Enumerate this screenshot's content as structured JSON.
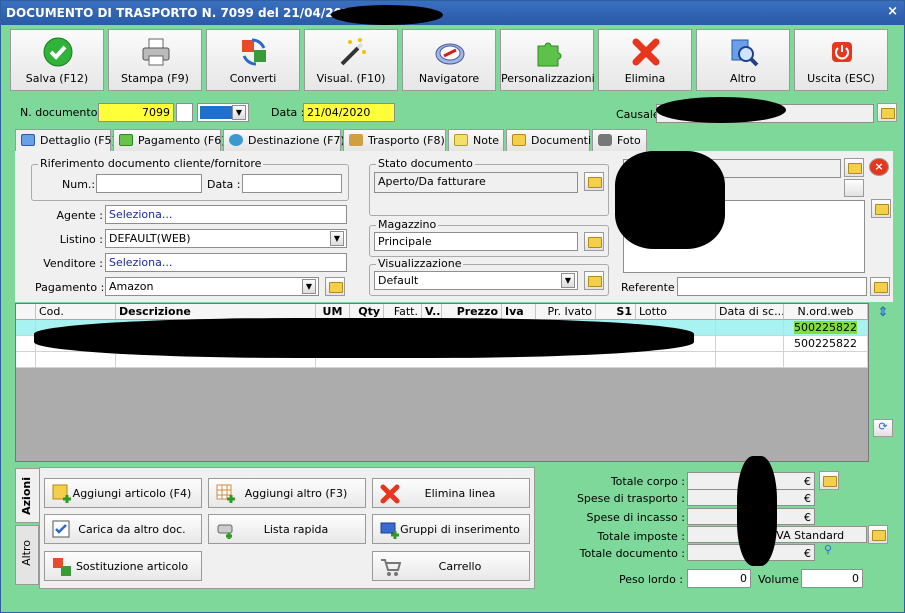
{
  "window": {
    "title": "DOCUMENTO DI TRASPORTO N. 7099 del 21/04/2020",
    "close_icon": "×"
  },
  "toolbar": [
    {
      "label": "Salva (F12)",
      "icon": "check-icon"
    },
    {
      "label": "Stampa (F9)",
      "icon": "printer-icon"
    },
    {
      "label": "Converti",
      "icon": "convert-icon"
    },
    {
      "label": "Visual. (F10)",
      "icon": "magic-wand-icon"
    },
    {
      "label": "Navigatore",
      "icon": "compass-icon"
    },
    {
      "label": "Personalizzazioni",
      "icon": "puzzle-icon"
    },
    {
      "label": "Elimina",
      "icon": "red-x-icon"
    },
    {
      "label": "Altro",
      "icon": "magnifier-icon"
    },
    {
      "label": "Uscita (ESC)",
      "icon": "power-icon"
    }
  ],
  "header": {
    "ndoc_label": "N. documento :",
    "ndoc_value": "7099",
    "data_label": "Data :",
    "data_value": "21/04/2020",
    "causale_label": "Causale"
  },
  "tabs": [
    "Dettaglio (F5)",
    "Pagamento (F6)",
    "Destinazione (F7)",
    "Trasporto (F8)",
    "Note",
    "Documenti",
    "Foto"
  ],
  "dettaglio": {
    "rif_legend": "Riferimento documento cliente/fornitore",
    "num_label": "Num.:",
    "data_label": "Data :",
    "agente_label": "Agente :",
    "agente_value": "Seleziona...",
    "listino_label": "Listino :",
    "listino_value": "DEFAULT(WEB)",
    "venditore_label": "Venditore :",
    "venditore_value": "Seleziona...",
    "pagamento_label": "Pagamento :",
    "pagamento_value": "Amazon",
    "stato_legend": "Stato documento",
    "stato_value": "Aperto/Da fatturare",
    "magazzino_legend": "Magazzino",
    "magazzino_value": "Principale",
    "visual_legend": "Visualizzazione",
    "visual_value": "Default",
    "referente_label": "Referente"
  },
  "grid": {
    "columns": [
      "Cod.",
      "Descrizione",
      "UM",
      "Qty",
      "Fatt.",
      "V...",
      "Prezzo",
      "Iva",
      "Pr. Ivato",
      "S1",
      "Lotto",
      "Data di sc...",
      "N.ord.web"
    ],
    "rows": [
      {
        "nordweb": "500225822"
      },
      {
        "nordweb": "500225822"
      }
    ]
  },
  "actions": {
    "tab_azioni": "Azioni",
    "tab_altro": "Altro",
    "buttons": [
      "Aggiungi articolo (F4)",
      "Aggiungi altro (F3)",
      "Elimina linea",
      "Carica da altro doc.",
      "Lista rapida",
      "Gruppi di inserimento",
      "Sostituzione articolo",
      "Carrello"
    ]
  },
  "totals": {
    "totale_corpo": "Totale corpo :",
    "spese_trasporto": "Spese di trasporto :",
    "spese_incasso": "Spese di incasso :",
    "totale_imposte": "Totale imposte :",
    "totale_documento": "Totale documento :",
    "peso_label": "Peso lordo :",
    "peso_value": "0",
    "volume_label": "Volume :",
    "volume_value": "0",
    "euro_symbol": "€",
    "iva_value": "IVA Standard"
  },
  "colors": {
    "window_bg": "#7ed89a",
    "title_bg": "#2a5aa8",
    "highlight": "#ffff3a",
    "selected_row": "#a9f2f2"
  }
}
